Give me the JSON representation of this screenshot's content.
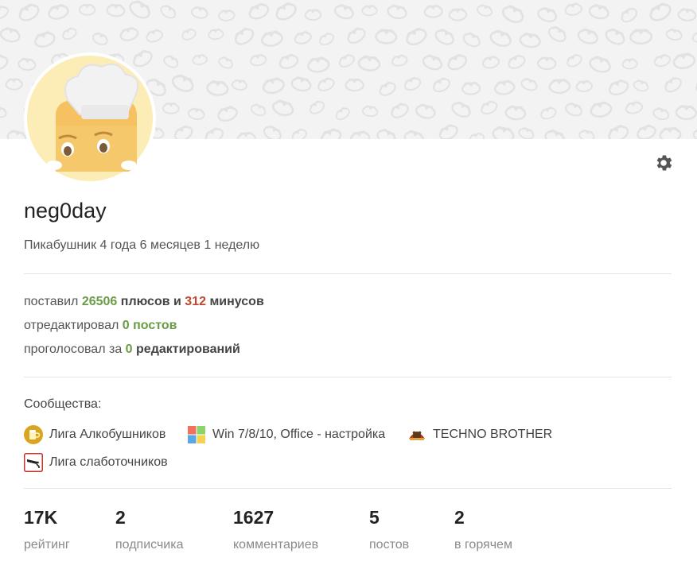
{
  "profile": {
    "username": "neg0day",
    "since": "Пикабушник 4 года 6 месяцев 1 неделю"
  },
  "activity": {
    "line1": {
      "prefix": "поставил ",
      "pluses": "26506",
      "mid": " плюсов и ",
      "minuses": "312",
      "suffix": " минусов"
    },
    "line2": {
      "prefix": "отредактировал ",
      "value": "0 постов"
    },
    "line3": {
      "prefix": "проголосовал за ",
      "value": "0",
      "suffix": " редактирований"
    }
  },
  "communities": {
    "title": "Сообщества:",
    "items": [
      {
        "label": "Лига Алкобушников",
        "icon": "beer-mug-icon"
      },
      {
        "label": "Win 7/8/10, Office - настройка",
        "icon": "windows-logo-icon"
      },
      {
        "label": "TECHNO BROTHER",
        "icon": "bear-logo-icon"
      },
      {
        "label": "Лига слаботочников",
        "icon": "cctv-camera-icon"
      }
    ]
  },
  "stats": [
    {
      "value": "17K",
      "label": "рейтинг"
    },
    {
      "value": "2",
      "label": "подписчика"
    },
    {
      "value": "1627",
      "label": "комментариев"
    },
    {
      "value": "5",
      "label": "постов"
    },
    {
      "value": "2",
      "label": "в горячем"
    }
  ],
  "colors": {
    "accent_green": "#6a9c45",
    "accent_red": "#c0472f",
    "banner_bg": "#f3f3f3"
  },
  "icons": {
    "settings": "gear-icon",
    "avatar": "chef-toast-avatar"
  }
}
